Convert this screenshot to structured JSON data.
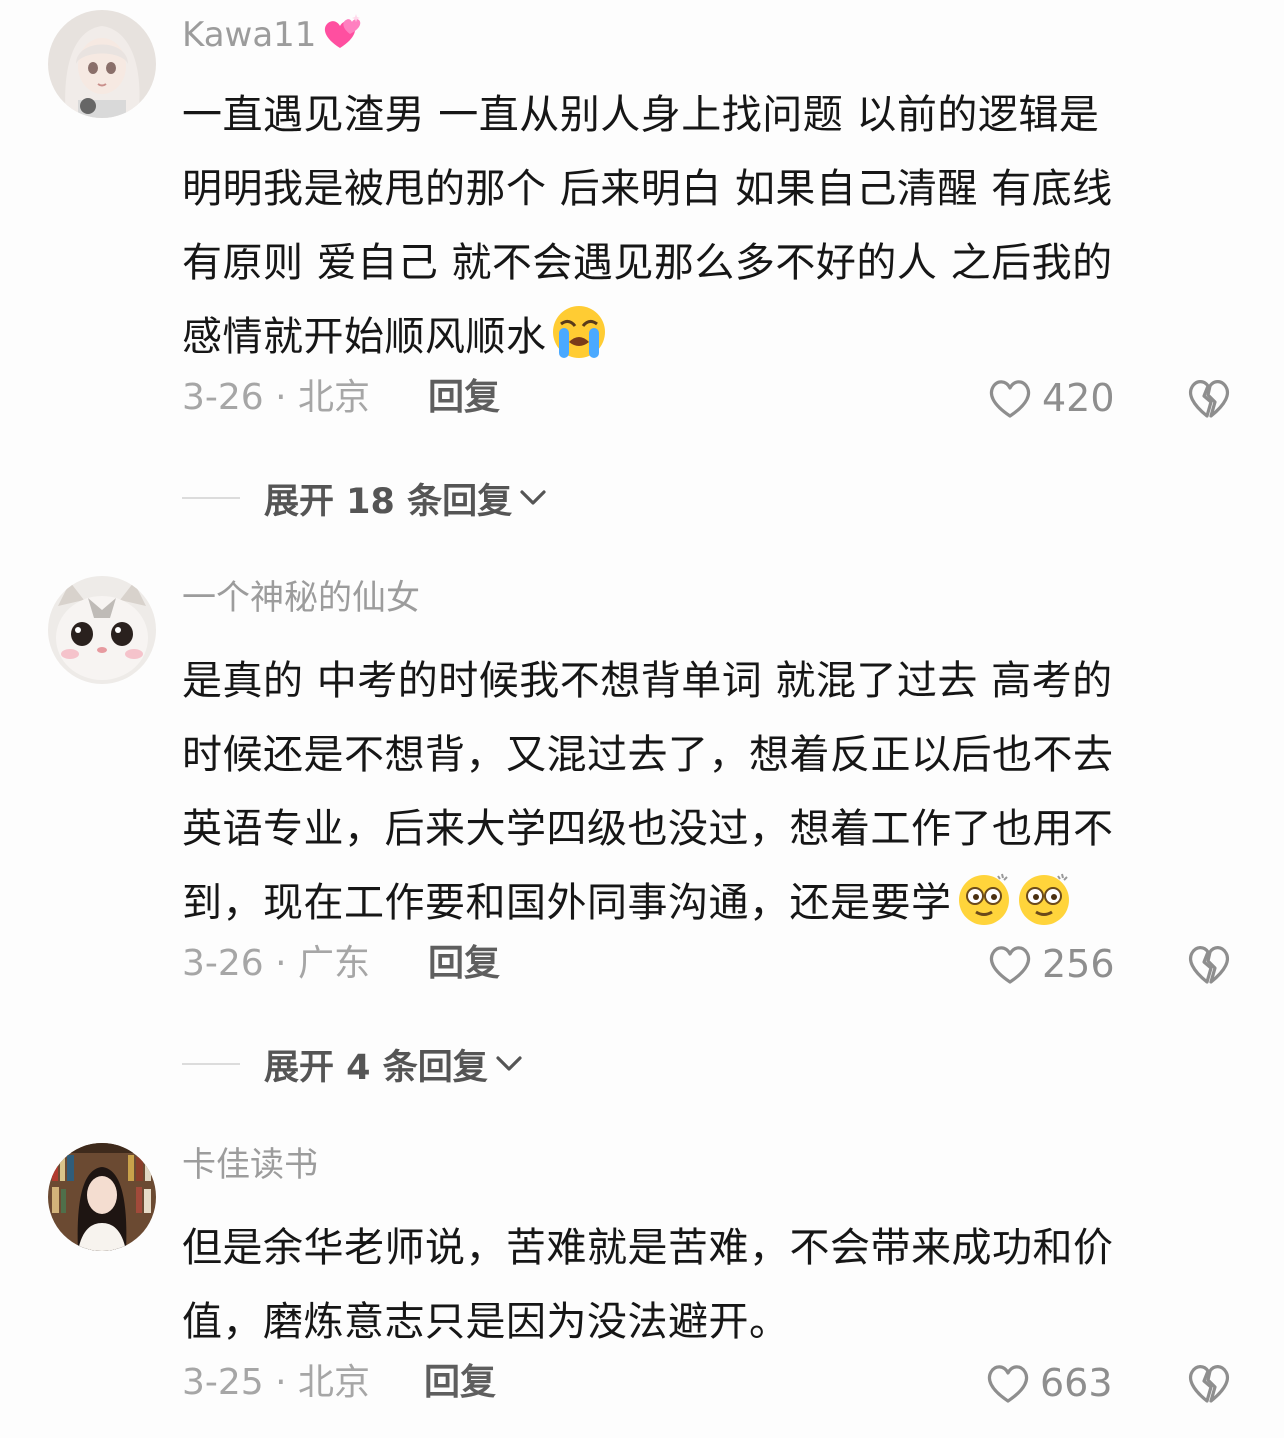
{
  "comments": [
    {
      "username": "Kawa11",
      "username_badge": "sparkling-heart-emoji",
      "lines": [
        "一直遇见渣男 一直从别人身上找问题 以前的逻辑是",
        "明明我是被甩的那个 后来明白 如果自己清醒  有底线",
        "有原则 爱自己 就不会遇见那么多不好的人 之后我的",
        "感情就开始顺风顺水"
      ],
      "trailing_emoji": "loudly-crying-face",
      "date_location": "3-26 · 北京",
      "reply_label": "回复",
      "likes": "420",
      "expand_label": "展开 18 条回复"
    },
    {
      "username": "一个神秘的仙女",
      "lines": [
        "是真的  中考的时候我不想背单词 就混了过去  高考的",
        "时候还是不想背，又混过去了，想着反正以后也不去",
        "英语专业，后来大学四级也没过，想着工作了也用不",
        "到，现在工作要和国外同事沟通，还是要学"
      ],
      "trailing_emoji": "dizzy-face x2",
      "date_location": "3-26 · 广东",
      "reply_label": "回复",
      "likes": "256",
      "expand_label": "展开 4 条回复"
    },
    {
      "username": "卡佳读书",
      "lines": [
        "但是余华老师说，苦难就是苦难，不会带来成功和价",
        "值，磨炼意志只是因为没法避开。"
      ],
      "date_location": "3-25 · 北京",
      "reply_label": "回复",
      "likes": "663"
    }
  ]
}
